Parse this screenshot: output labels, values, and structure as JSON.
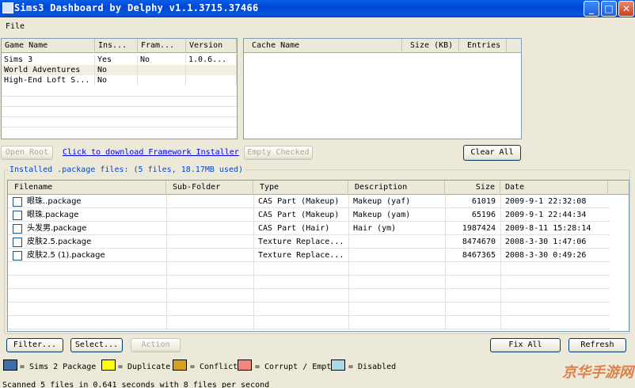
{
  "window": {
    "title": "Sims3 Dashboard by Delphy v1.1.3715.37466",
    "minimize": "_",
    "maximize": "□",
    "close": "✕"
  },
  "menu": {
    "file": "File"
  },
  "games": {
    "headers": [
      "Game Name",
      "Ins...",
      "Fram...",
      "Version"
    ],
    "rows": [
      [
        "Sims 3",
        "Yes",
        "No",
        "1.0.6..."
      ],
      [
        "World Adventures",
        "No",
        "",
        ""
      ],
      [
        "High-End Loft S...",
        "No",
        "",
        ""
      ]
    ]
  },
  "cache": {
    "headers": [
      "Cache Name",
      "Size (KB)",
      "Entries"
    ]
  },
  "actions": {
    "open_root": "Open Root",
    "download_link": "Click to download Framework Installer",
    "empty_checked": "Empty Checked",
    "clear_all": "Clear All"
  },
  "packages": {
    "group_title": "Installed .package files: (5 files, 18.17MB used)",
    "headers": [
      "Filename",
      "Sub-Folder",
      "Type",
      "Description",
      "Size",
      "Date"
    ],
    "rows": [
      [
        "眼珠..package",
        "",
        "CAS Part (Makeup)",
        "Makeup (yaf)",
        "61019",
        "2009-9-1 22:32:08"
      ],
      [
        "眼珠.package",
        "",
        "CAS Part (Makeup)",
        "Makeup (yam)",
        "65196",
        "2009-9-1 22:44:34"
      ],
      [
        "头发男.package",
        "",
        "CAS Part (Hair)",
        "Hair (ym)",
        "1987424",
        "2009-8-11 15:28:14"
      ],
      [
        "皮肤2.5.package",
        "",
        "Texture Replace...",
        "",
        "8474670",
        "2008-3-30 1:47:06"
      ],
      [
        "皮肤2.5 (1).package",
        "",
        "Texture Replace...",
        "",
        "8467365",
        "2008-3-30 0:49:26"
      ]
    ]
  },
  "bottom_buttons": {
    "filter": "Filter...",
    "select": "Select...",
    "action": "Action",
    "fix_all": "Fix All",
    "refresh": "Refresh"
  },
  "legend": [
    {
      "label": "= Sims 2 Package",
      "color": "#3f6fa8"
    },
    {
      "label": "= Duplicate",
      "color": "#ffff00"
    },
    {
      "label": "= Conflict",
      "color": "#d4a020"
    },
    {
      "label": "= Corrupt / Empty",
      "color": "#f4877a"
    },
    {
      "label": "= Disabled",
      "color": "#add8e6"
    }
  ],
  "status": "Scanned 5 files in 0.641 seconds with 8 files per second",
  "watermark": "京华手游网"
}
